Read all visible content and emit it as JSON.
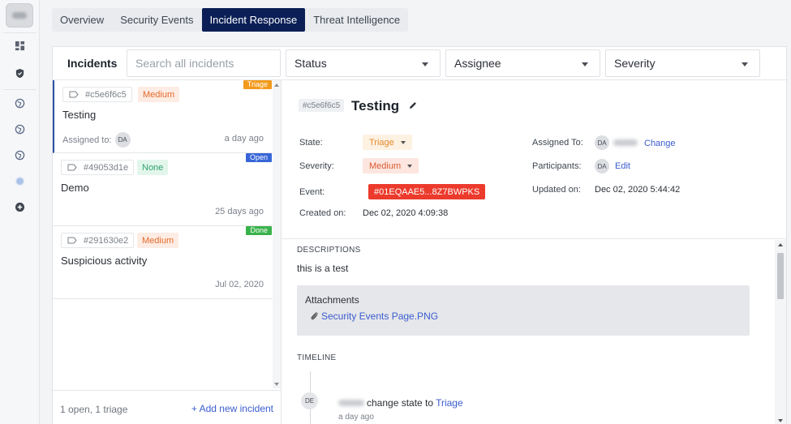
{
  "tabs": [
    {
      "label": "Overview"
    },
    {
      "label": "Security Events"
    },
    {
      "label": "Incident Response"
    },
    {
      "label": "Threat Intelligence"
    }
  ],
  "filters": {
    "title": "Incidents",
    "search_placeholder": "Search all incidents",
    "status": "Status",
    "assignee": "Assignee",
    "severity": "Severity"
  },
  "incidents": [
    {
      "id": "#c5e6f6c5",
      "severity": "Medium",
      "ribbon": "Triage",
      "ribbon_color": "#f39a1c",
      "name": "Testing",
      "assigned_label": "Assigned to:",
      "assignee": "DA",
      "age": "a day ago"
    },
    {
      "id": "#49053d1e",
      "severity": "None",
      "ribbon": "Open",
      "ribbon_color": "#3866d8",
      "name": "Demo",
      "age": "25 days ago"
    },
    {
      "id": "#291630e2",
      "severity": "Medium",
      "ribbon": "Done",
      "ribbon_color": "#39b24b",
      "name": "Suspicious activity",
      "age": "Jul 02, 2020"
    }
  ],
  "list_footer": {
    "count": "1 open, 1 triage",
    "add": "+ Add new incident"
  },
  "detail": {
    "id": "#c5e6f6c5",
    "title": "Testing",
    "state_label": "State:",
    "state": "Triage",
    "severity_label": "Severity:",
    "severity": "Medium",
    "event_label": "Event:",
    "event": "#01EQAAE5...8Z7BWPKS",
    "created_label": "Created on:",
    "created": "Dec 02, 2020 4:09:38",
    "assigned_label": "Assigned To:",
    "assigned_avatar": "DA",
    "change": "Change",
    "participants_label": "Participants:",
    "participants_avatar": "DA",
    "edit": "Edit",
    "updated_label": "Updated on:",
    "updated": "Dec 02, 2020 5:44:42"
  },
  "descriptions": {
    "heading": "DESCRIPTIONS",
    "text": "this is a test",
    "attachments_heading": "Attachments",
    "file": "Security Events Page.PNG"
  },
  "timeline": {
    "heading": "TIMELINE",
    "avatar": "DE",
    "action": "change state to",
    "target": "Triage",
    "time": "a day ago"
  },
  "colors": {
    "accent": "#0b1f56",
    "link": "#3a5ccf",
    "event": "#ec3a2c"
  }
}
